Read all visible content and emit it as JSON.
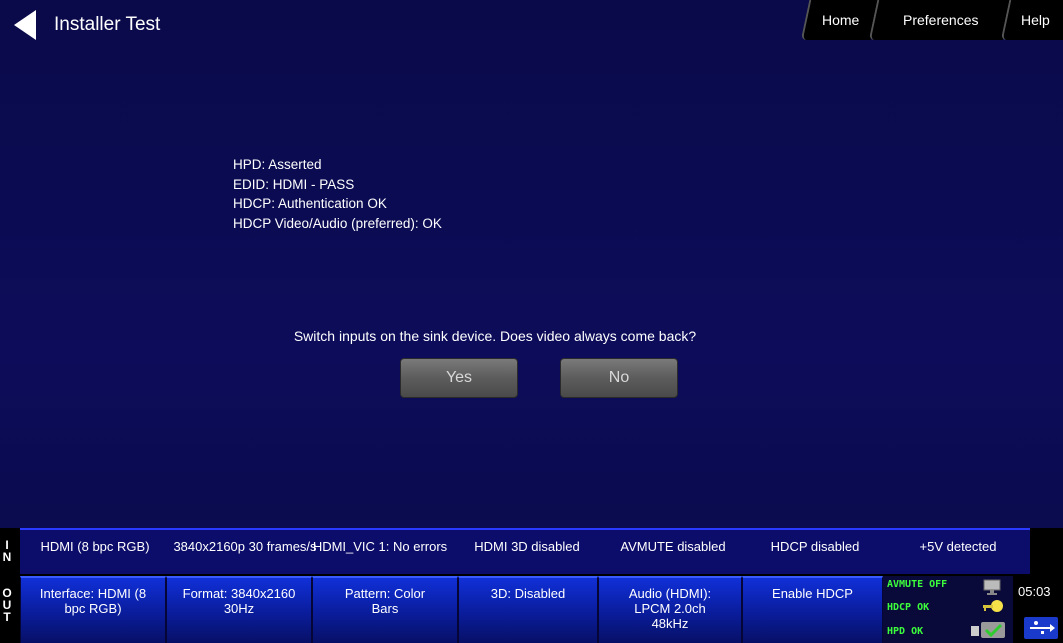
{
  "header": {
    "title": "Installer Test",
    "tabs": [
      "Home",
      "Preferences",
      "Help"
    ]
  },
  "status_lines": [
    "HPD: Asserted",
    "EDID: HDMI - PASS",
    "HDCP: Authentication OK",
    "HDCP Video/Audio (preferred): OK"
  ],
  "question": "Switch inputs on the sink device.  Does video always come back?",
  "buttons": {
    "yes": "Yes",
    "no": "No"
  },
  "in_row": {
    "letters": [
      "I",
      "N"
    ],
    "cells": [
      "HDMI (8 bpc RGB)",
      "3840x2160p 30 frames/s",
      "HDMI_VIC 1: No errors",
      "HDMI 3D disabled",
      "AVMUTE disabled",
      "HDCP disabled",
      "+5V detected"
    ]
  },
  "out_row": {
    "letters": [
      "O",
      "U",
      "T"
    ],
    "tiles": [
      "Interface: HDMI (8 bpc RGB)",
      "Format: 3840x2160 30Hz",
      "Pattern: Color Bars",
      "3D: Disabled",
      "Audio (HDMI): LPCM 2.0ch 48kHz",
      "Enable HDCP"
    ],
    "status_panel": [
      "AVMUTE OFF",
      "HDCP OK",
      "HPD OK"
    ],
    "time": "05:03"
  },
  "icons": [
    "back-arrow-icon",
    "monitor-icon",
    "key-icon",
    "cable-check-icon",
    "usb-icon"
  ],
  "colors": {
    "background": "#0c0c5a",
    "tile_blue": "#1030d8",
    "status_green": "#3cff3c"
  }
}
